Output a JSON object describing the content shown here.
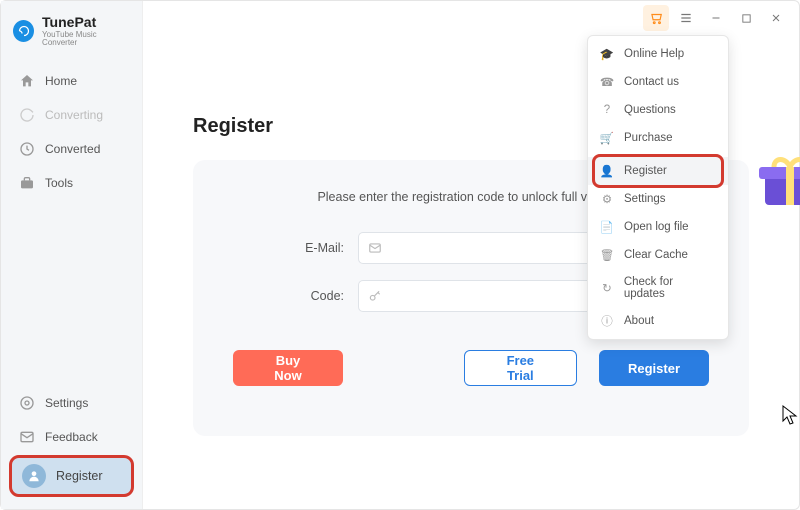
{
  "app": {
    "name": "TunePat",
    "subtitle": "YouTube Music Converter"
  },
  "sidebar": {
    "nav": [
      {
        "label": "Home"
      },
      {
        "label": "Converting"
      },
      {
        "label": "Converted"
      },
      {
        "label": "Tools"
      }
    ],
    "bottom": [
      {
        "label": "Settings"
      },
      {
        "label": "Feedback"
      }
    ],
    "register": "Register"
  },
  "page": {
    "title": "Register",
    "instruction": "Please enter the registration code to unlock full version.",
    "fields": {
      "email_label": "E-Mail:",
      "code_label": "Code:"
    },
    "buttons": {
      "buy": "Buy Now",
      "trial": "Free Trial",
      "register": "Register"
    }
  },
  "menu": {
    "items": [
      "Online Help",
      "Contact us",
      "Questions",
      "Purchase",
      "Register",
      "Settings",
      "Open log file",
      "Clear Cache",
      "Check for updates",
      "About"
    ]
  }
}
